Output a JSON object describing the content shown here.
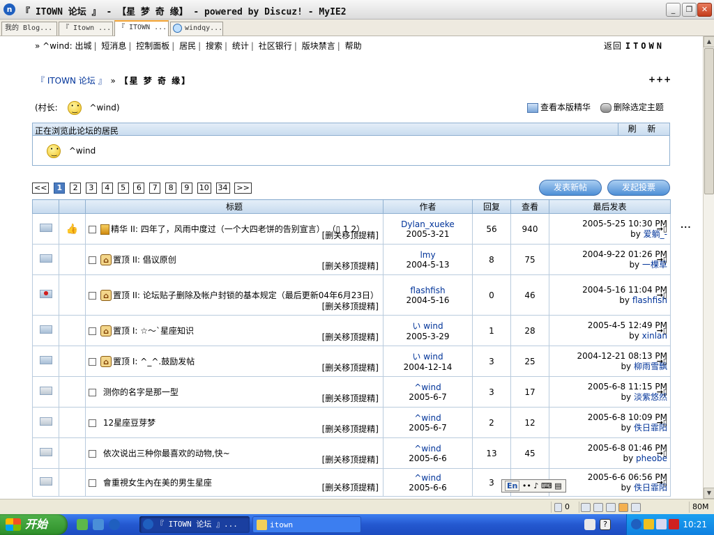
{
  "window": {
    "title": "『 ITOWN 论坛 』 - 【星 梦 奇 缘】 - powered by Discuz! - MyIE2",
    "app_icon": "n"
  },
  "tabs": [
    {
      "label": "我的 Blog...",
      "active": false
    },
    {
      "label": "『 Itown ...",
      "active": false
    },
    {
      "label": "『 ITOWN ...",
      "active": true
    },
    {
      "label": "windqy...",
      "active": false
    }
  ],
  "topnav": {
    "prefix": "» ^wind:",
    "items": [
      "出城",
      "短消息",
      "控制面板",
      "居民",
      "搜索",
      "统计",
      "社区银行",
      "版块禁言",
      "帮助"
    ],
    "back_label": "返回",
    "back_brand": "ITOWN"
  },
  "breadcrumb": {
    "forum": "『 ITOWN 论坛 』",
    "sep": "»",
    "current": "【星 梦 奇 缘】",
    "more": "+++"
  },
  "moderator": {
    "label": "(村长:",
    "name": "^wind)",
    "view_digest": "查看本版精华",
    "delete_selected": "删除选定主题"
  },
  "online": {
    "title": "正在浏览此论坛的居民",
    "refresh": "刷 新",
    "user": "^wind"
  },
  "pager": {
    "prev": "<<",
    "pages": [
      "1",
      "2",
      "3",
      "4",
      "5",
      "6",
      "7",
      "8",
      "9",
      "10"
    ],
    "current": "1",
    "ellipsis": "...",
    "last": "34",
    "next": ">>"
  },
  "buttons": {
    "new_post": "发表新帖",
    "new_poll": "发起投票"
  },
  "table": {
    "headers": {
      "title": "标题",
      "author": "作者",
      "replies": "回复",
      "views": "查看",
      "last": "最后发表"
    },
    "mod_links": "[删关移顶提精]",
    "rows": [
      {
        "status": "normal",
        "flag": "👍",
        "type": "digest",
        "type_label": "精华",
        "level": "II:",
        "title": "四年了，风雨中度过（一个大四老饼的告别宣言）",
        "pages": "（▯ 1 2）",
        "author": "Dylan_xueke",
        "date": "2005-3-21",
        "replies": "56",
        "views": "940",
        "last_time": "2005-5-25 10:30 PM",
        "last_by": "by",
        "last_user": "爱躺_-"
      },
      {
        "status": "normal",
        "flag": "",
        "type": "top",
        "type_label": "置顶",
        "level": "II:",
        "title": "倡议原创",
        "pages": "",
        "author": "lmy",
        "date": "2004-5-13",
        "replies": "8",
        "views": "75",
        "last_time": "2004-9-22 01:26 PM",
        "last_by": "by",
        "last_user": "一棵草"
      },
      {
        "status": "hot",
        "flag": "",
        "type": "top",
        "type_label": "置顶",
        "level": "II:",
        "title": "论坛贴子删除及帐户封锁的基本规定（最后更新04年6月23日）",
        "pages": "",
        "author": "flashfish",
        "date": "2004-5-16",
        "replies": "0",
        "views": "46",
        "last_time": "2004-5-16 11:04 PM",
        "last_by": "by",
        "last_user": "flashfish"
      },
      {
        "status": "normal",
        "flag": "",
        "type": "top",
        "type_label": "置顶",
        "level": "I:",
        "title": "☆～`星座知识",
        "pages": "",
        "author": "い wind",
        "date": "2005-3-29",
        "replies": "1",
        "views": "28",
        "last_time": "2005-4-5 12:49 PM",
        "last_by": "by",
        "last_user": "xinlan"
      },
      {
        "status": "normal",
        "flag": "",
        "type": "top",
        "type_label": "置顶",
        "level": "I:",
        "title": "^_^.鼓励发帖",
        "pages": "",
        "author": "い wind",
        "date": "2004-12-14",
        "replies": "3",
        "views": "25",
        "last_time": "2004-12-21 08:13 PM",
        "last_by": "by",
        "last_user": "柳雨雪飘"
      },
      {
        "status": "plain",
        "flag": "",
        "type": "",
        "type_label": "",
        "level": "",
        "title": "测你的名字是那一型",
        "pages": "",
        "author": "^wind",
        "date": "2005-6-7",
        "replies": "3",
        "views": "17",
        "last_time": "2005-6-8 11:15 PM",
        "last_by": "by",
        "last_user": "淡紫悠然"
      },
      {
        "status": "plain",
        "flag": "",
        "type": "",
        "type_label": "",
        "level": "",
        "title": "12星座豆芽梦",
        "pages": "",
        "author": "^wind",
        "date": "2005-6-7",
        "replies": "2",
        "views": "12",
        "last_time": "2005-6-8 10:09 PM",
        "last_by": "by",
        "last_user": "佚日霏阳"
      },
      {
        "status": "plain",
        "flag": "",
        "type": "",
        "type_label": "",
        "level": "",
        "title": "依次说出三种你最喜欢的动物,快~",
        "pages": "",
        "author": "^wind",
        "date": "2005-6-6",
        "replies": "13",
        "views": "45",
        "last_time": "2005-6-8 01:46 PM",
        "last_by": "by",
        "last_user": "pheobe"
      },
      {
        "status": "plain",
        "flag": "",
        "type": "",
        "type_label": "",
        "level": "",
        "title": "會重視女生內在美的男生星座",
        "pages": "",
        "author": "^wind",
        "date": "2005-6-6",
        "replies": "3",
        "views": "",
        "last_time": "2005-6-6 06:56 PM",
        "last_by": "by",
        "last_user": "佚日霏阳"
      }
    ]
  },
  "ime": {
    "lang": "En",
    "rest": "•• ♪ ⌨ ▤"
  },
  "statusbar": {
    "count": "0",
    "memory": "80M"
  },
  "taskbar": {
    "start": "开始",
    "tasks": [
      {
        "label": "『 ITOWN 论坛 』...",
        "active": true
      },
      {
        "label": "itown",
        "active": false
      }
    ],
    "clock": "10:21"
  },
  "colors": {
    "header_blue": "#c6daee",
    "border_blue": "#8fb0d0",
    "link": "#003399",
    "taskbar": "#2458d0"
  }
}
